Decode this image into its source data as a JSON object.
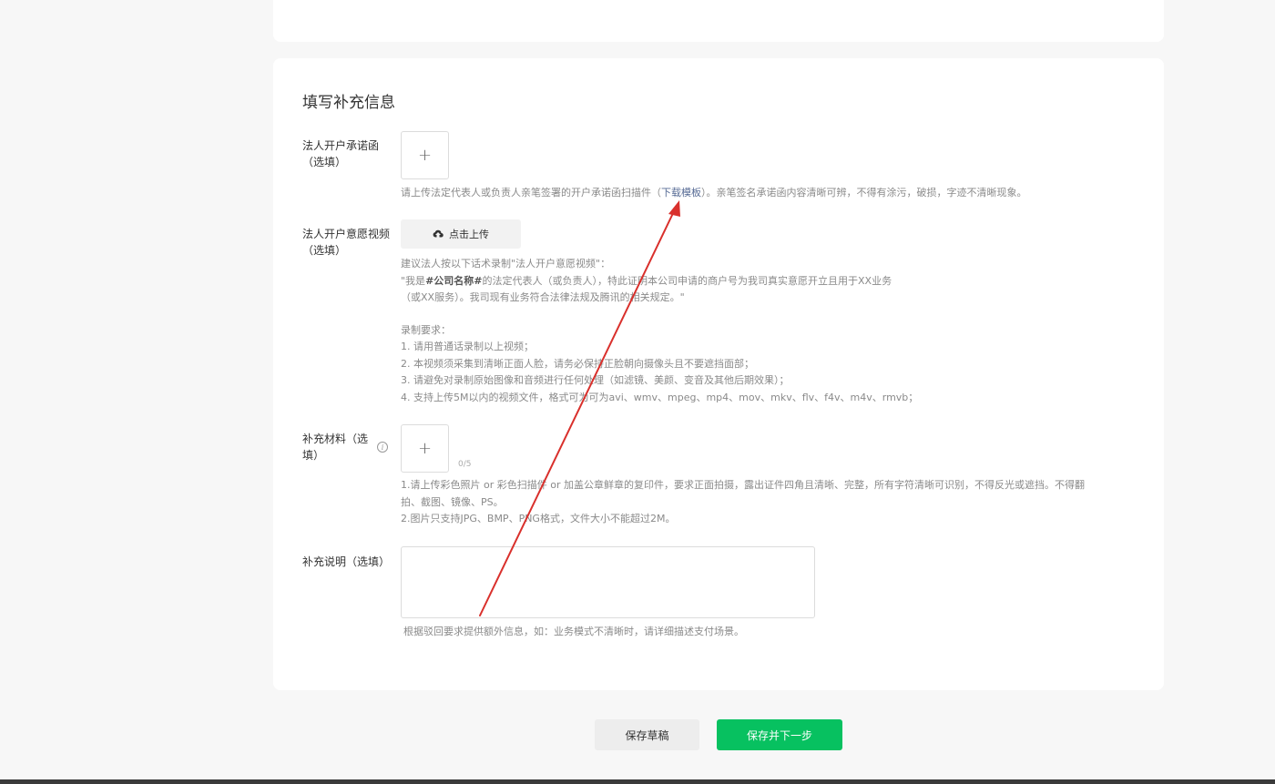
{
  "section": {
    "title": "填写补充信息"
  },
  "commitment_letter": {
    "label_line1": "法人开户承诺函",
    "label_line2": "（选填）",
    "upload_glyph": "+",
    "hint_prefix": "请上传法定代表人或负责人亲笔签署的开户承诺函扫描件（",
    "hint_link": "下载模板",
    "hint_suffix": "）。亲笔签名承诺函内容清晰可辨，不得有涂污，破损，字迹不清晰现象。"
  },
  "intent_video": {
    "label_line1": "法人开户意愿视频",
    "label_line2": "（选填）",
    "upload_button_label": "点击上传",
    "upload_icon": "cloud-upload-icon",
    "script_intro": "建议法人按以下话术录制\"法人开户意愿视频\"：",
    "script_line1_a": "\"我是",
    "script_line1_bold": "#公司名称#",
    "script_line1_b": "的法定代表人（或负责人），特此证明本公司申请的商户号为我司真实意愿开立且用于XX业务",
    "script_line2": "（或XX服务）。我司现有业务符合法律法规及腾讯的相关规定。\"",
    "req_title": "录制要求：",
    "req_items": [
      "1. 请用普通话录制以上视频；",
      "2. 本视频须采集到清晰正面人脸，请务必保持正脸朝向摄像头且不要遮挡面部；",
      "3. 请避免对录制原始图像和音频进行任何处理（如滤镜、美颜、变音及其他后期效果）；",
      "4. 支持上传5M以内的视频文件，格式可为可为avi、wmv、mpeg、mp4、mov、mkv、flv、f4v、m4v、rmvb；"
    ]
  },
  "supplementary_materials": {
    "label_line1": "补充材料（选",
    "label_line2": "填）",
    "info_glyph": "i",
    "upload_glyph": "+",
    "counter": "0/5",
    "hint_line1": "1.请上传彩色照片 or 彩色扫描件 or 加盖公章鲜章的复印件，要求正面拍摄，露出证件四角且清晰、完整，所有字符清晰可识别，不得反光或遮挡。不得翻",
    "hint_line2": "拍、截图、镜像、PS。",
    "hint_line3": "2.图片只支持JPG、BMP、PNG格式，文件大小不能超过2M。"
  },
  "supplementary_note": {
    "label": "补充说明（选填）",
    "value": "",
    "hint": "根据驳回要求提供额外信息，如：业务模式不清晰时，请详细描述支付场景。"
  },
  "footer": {
    "save_draft_label": "保存草稿",
    "save_next_label": "保存并下一步"
  },
  "colors": {
    "primary_green": "#07c160",
    "link_blue": "#576b95",
    "arrow_red": "#d9302c"
  }
}
